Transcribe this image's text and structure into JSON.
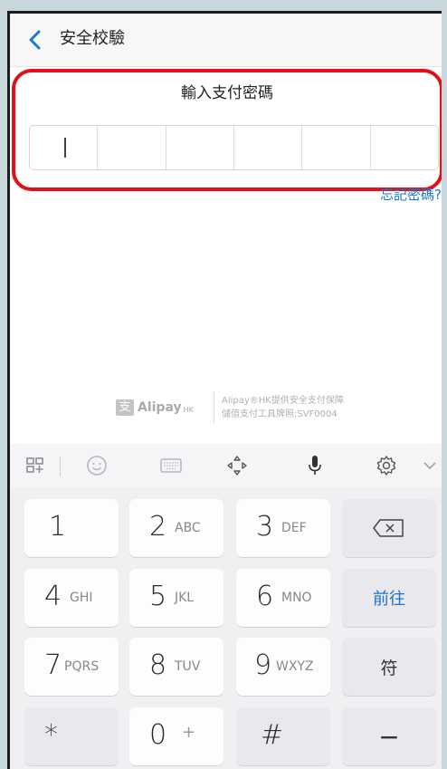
{
  "header": {
    "title": "安全校驗"
  },
  "password": {
    "label": "輸入支付密碼",
    "cells": 6,
    "forgot": "忘記密碼?"
  },
  "brand": {
    "logo_mark": "支",
    "logo_word": "Alipay",
    "logo_suffix": "HK",
    "line1": "Alipay®HK提供安全支付保障",
    "line2": "儲值支付工具牌照:SVF0004"
  },
  "toolbar": {
    "icons": [
      "layout-icon",
      "emoji-icon",
      "keyboard-icon",
      "cursor-move-icon",
      "microphone-icon",
      "settings-icon",
      "collapse-icon"
    ]
  },
  "keyboard": {
    "rows": [
      [
        {
          "digit": "1",
          "letters": ""
        },
        {
          "digit": "2",
          "letters": "ABC"
        },
        {
          "digit": "3",
          "letters": "DEF"
        }
      ],
      [
        {
          "digit": "4",
          "letters": "GHI"
        },
        {
          "digit": "5",
          "letters": "JKL"
        },
        {
          "digit": "6",
          "letters": "MNO"
        }
      ],
      [
        {
          "digit": "7",
          "letters": "PQRS"
        },
        {
          "digit": "8",
          "letters": "TUV"
        },
        {
          "digit": "9",
          "letters": "WXYZ"
        }
      ],
      [
        {
          "digit": "*",
          "letters": ""
        },
        {
          "digit": "0",
          "letters": "+"
        },
        {
          "digit": "#",
          "letters": ""
        }
      ]
    ],
    "side": {
      "backspace": "backspace-icon",
      "go": "前往",
      "symbol": "符",
      "dash": "−"
    }
  },
  "colors": {
    "accent": "#1a73c8",
    "highlight": "#e3101a"
  }
}
